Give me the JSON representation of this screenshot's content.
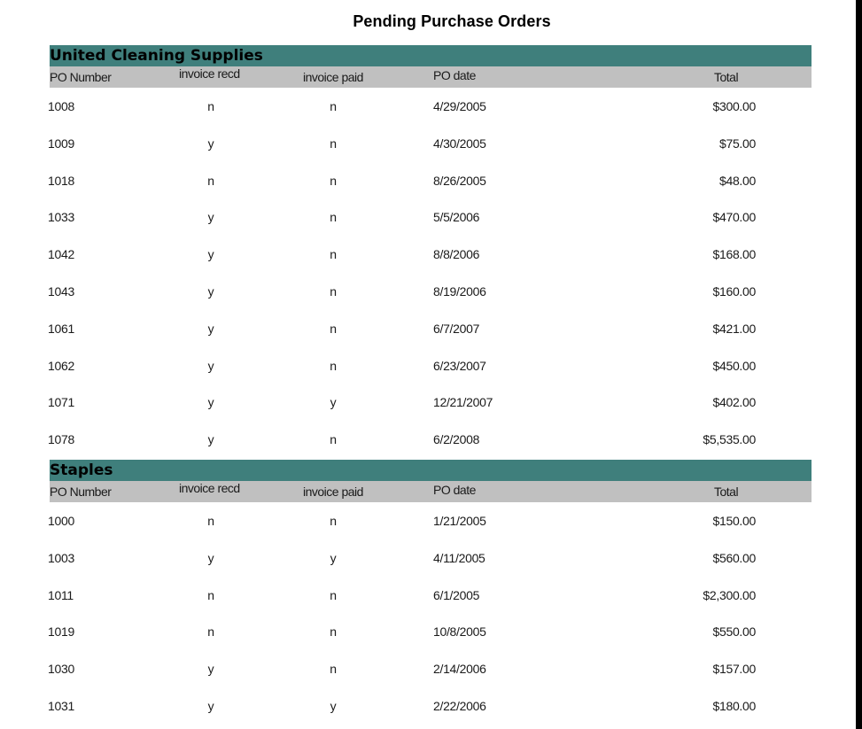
{
  "report": {
    "title": "Pending Purchase Orders"
  },
  "columns": {
    "po_number": "PO Number",
    "invoice_recd": "invoice recd",
    "invoice_paid": "invoice paid",
    "po_date": "PO date",
    "total": "Total"
  },
  "groups": [
    {
      "vendor": "United Cleaning Supplies",
      "rows": [
        {
          "po": "1008",
          "recd": "n",
          "paid": "n",
          "date": "4/29/2005",
          "total": "$300.00"
        },
        {
          "po": "1009",
          "recd": "y",
          "paid": "n",
          "date": "4/30/2005",
          "total": "$75.00"
        },
        {
          "po": "1018",
          "recd": "n",
          "paid": "n",
          "date": "8/26/2005",
          "total": "$48.00"
        },
        {
          "po": "1033",
          "recd": "y",
          "paid": "n",
          "date": "5/5/2006",
          "total": "$470.00"
        },
        {
          "po": "1042",
          "recd": "y",
          "paid": "n",
          "date": "8/8/2006",
          "total": "$168.00"
        },
        {
          "po": "1043",
          "recd": "y",
          "paid": "n",
          "date": "8/19/2006",
          "total": "$160.00"
        },
        {
          "po": "1061",
          "recd": "y",
          "paid": "n",
          "date": "6/7/2007",
          "total": "$421.00"
        },
        {
          "po": "1062",
          "recd": "y",
          "paid": "n",
          "date": "6/23/2007",
          "total": "$450.00"
        },
        {
          "po": "1071",
          "recd": "y",
          "paid": "y",
          "date": "12/21/2007",
          "total": "$402.00"
        },
        {
          "po": "1078",
          "recd": "y",
          "paid": "n",
          "date": "6/2/2008",
          "total": "$5,535.00"
        }
      ]
    },
    {
      "vendor": "Staples",
      "rows": [
        {
          "po": "1000",
          "recd": "n",
          "paid": "n",
          "date": "1/21/2005",
          "total": "$150.00"
        },
        {
          "po": "1003",
          "recd": "y",
          "paid": "y",
          "date": "4/11/2005",
          "total": "$560.00"
        },
        {
          "po": "1011",
          "recd": "n",
          "paid": "n",
          "date": "6/1/2005",
          "total": "$2,300.00"
        },
        {
          "po": "1019",
          "recd": "n",
          "paid": "n",
          "date": "10/8/2005",
          "total": "$550.00"
        },
        {
          "po": "1030",
          "recd": "y",
          "paid": "n",
          "date": "2/14/2006",
          "total": "$157.00"
        },
        {
          "po": "1031",
          "recd": "y",
          "paid": "y",
          "date": "2/22/2006",
          "total": "$180.00"
        }
      ]
    }
  ],
  "colors": {
    "group_header_bg": "#3f7f7c",
    "column_header_bg": "#c0c0c0"
  }
}
